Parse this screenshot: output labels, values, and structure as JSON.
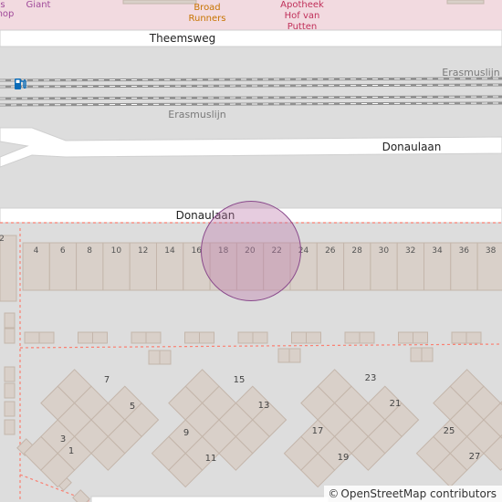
{
  "map": {
    "poi_top": {
      "fragment_1": "s",
      "fragment_2": "hop",
      "giant": "Giant",
      "broad_runners": [
        "Broad",
        "Runners"
      ],
      "apotheek": [
        "Apotheek",
        "Hof van",
        "Putten"
      ]
    },
    "streets": {
      "theemsweg": "Theemsweg",
      "donaulaan_upper": "Donaulaan",
      "donaulaan_lower": "Donaulaan"
    },
    "railway": {
      "erasmuslijn_right": "Erasmuslijn",
      "erasmuslijn_left": "Erasmuslijn"
    },
    "icons": {
      "fuel": "fuel-station-icon"
    },
    "house_numbers": [
      "2",
      "4",
      "6",
      "8",
      "10",
      "12",
      "14",
      "16",
      "18",
      "20",
      "22",
      "24",
      "26",
      "28",
      "30",
      "32",
      "34",
      "36",
      "38"
    ],
    "building_numbers": [
      "7",
      "5",
      "3",
      "1",
      "15",
      "13",
      "9",
      "11",
      "23",
      "21",
      "17",
      "19",
      "25",
      "27"
    ],
    "attribution": {
      "symbol": "©",
      "text": "OpenStreetMap contributors"
    },
    "colors": {
      "background": "#dddddd",
      "road": "#ffffff",
      "building": "#d9d0c9",
      "building_outline": "#c4b6ab",
      "marker_fill": "#be78aa",
      "marker_stroke": "#8a4a8c",
      "footpath": "#fa8072",
      "commercial": "#f2dae0"
    }
  }
}
